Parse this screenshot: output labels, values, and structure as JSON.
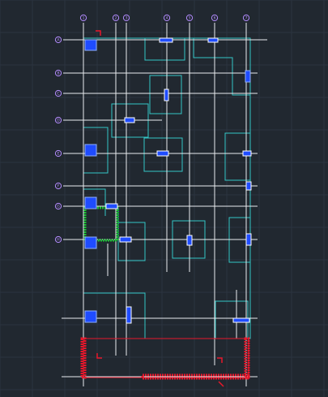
{
  "drawing": {
    "background_color": "#212830",
    "grid_color": "#2c3440",
    "axis_line_color": "#e9ecef",
    "outline_color": "#33c6c6",
    "column_color": "#1f4cff",
    "column_edge_color": "#8fb0ff",
    "beam_marker_color": "#ffffff",
    "hatch_red_color": "#e8172b",
    "hatch_green_color": "#19c132",
    "axis_bubble_color": "#b48cff",
    "column_axis_labels": [
      "1",
      "2",
      "3",
      "4",
      "5",
      "6",
      "7"
    ],
    "row_axis_labels": [
      "A",
      "B",
      "C",
      "D",
      "E",
      "F",
      "G",
      "H"
    ]
  }
}
